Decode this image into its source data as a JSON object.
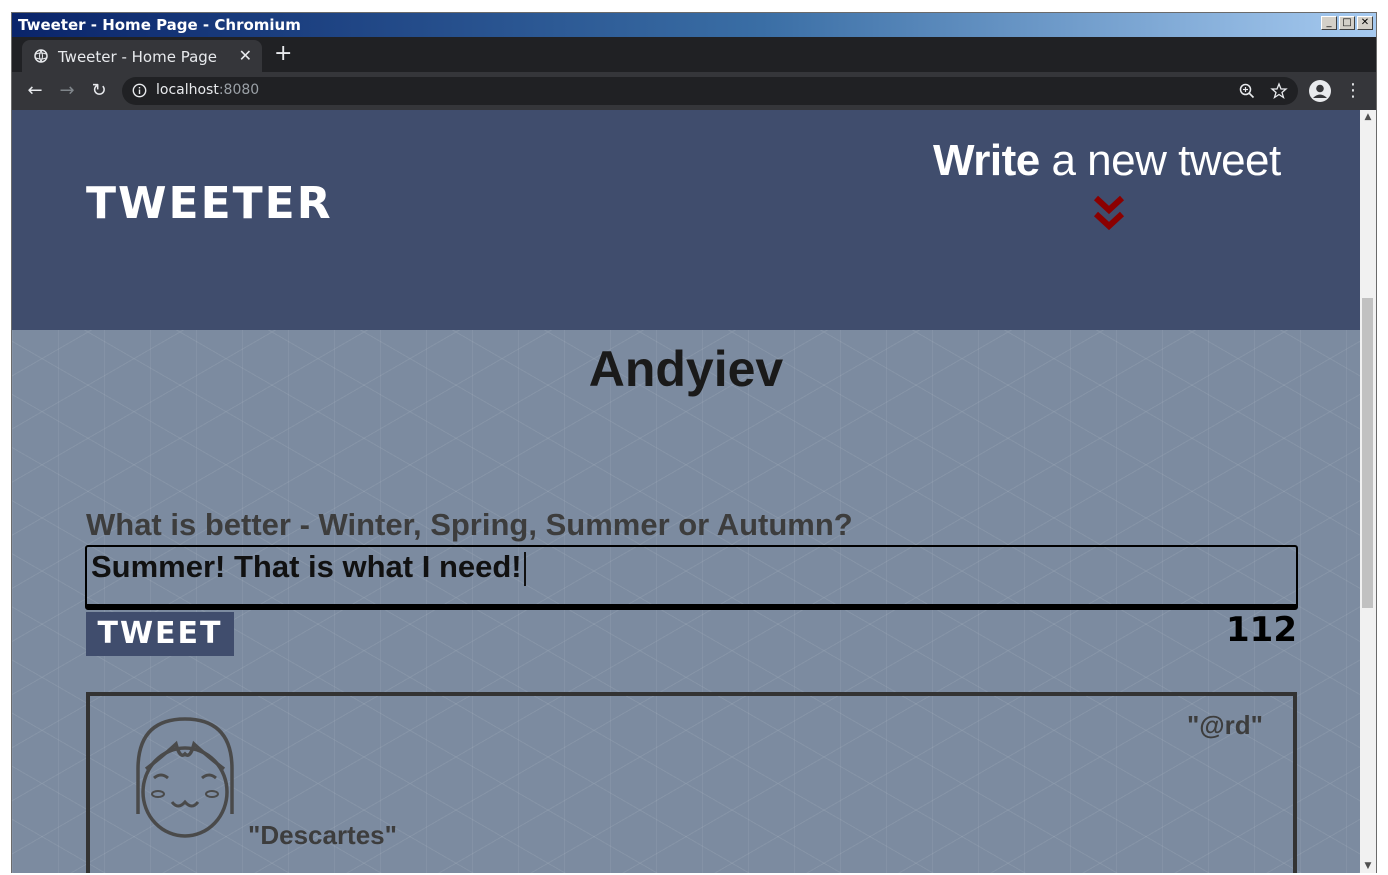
{
  "window": {
    "title": "Tweeter - Home Page - Chromium",
    "controls": {
      "minimize": "_",
      "maximize": "□",
      "close": "✕"
    }
  },
  "browser": {
    "tab_title": "Tweeter - Home Page",
    "tab_close": "✕",
    "new_tab": "+",
    "url_host": "localhost",
    "url_port": ":8080",
    "back": "←",
    "forward": "→",
    "reload": "↻",
    "menu": "⋮"
  },
  "header": {
    "logo": "Tweeter",
    "cta_bold": "Write",
    "cta_light": " a new tweet",
    "chevron_color": "#8b0000"
  },
  "profile": {
    "username": "Andyiev"
  },
  "composer": {
    "prompt": "What is better - Winter, Spring, Summer or Autumn?",
    "value": "Summer! That is what I need!",
    "submit_label": "Tweet",
    "char_counter": "112"
  },
  "tweets": [
    {
      "display_name": "\"Descartes\"",
      "handle": "\"@rd\""
    }
  ],
  "colors": {
    "header_bg": "#404d6d",
    "content_bg": "#7c8ba0"
  }
}
